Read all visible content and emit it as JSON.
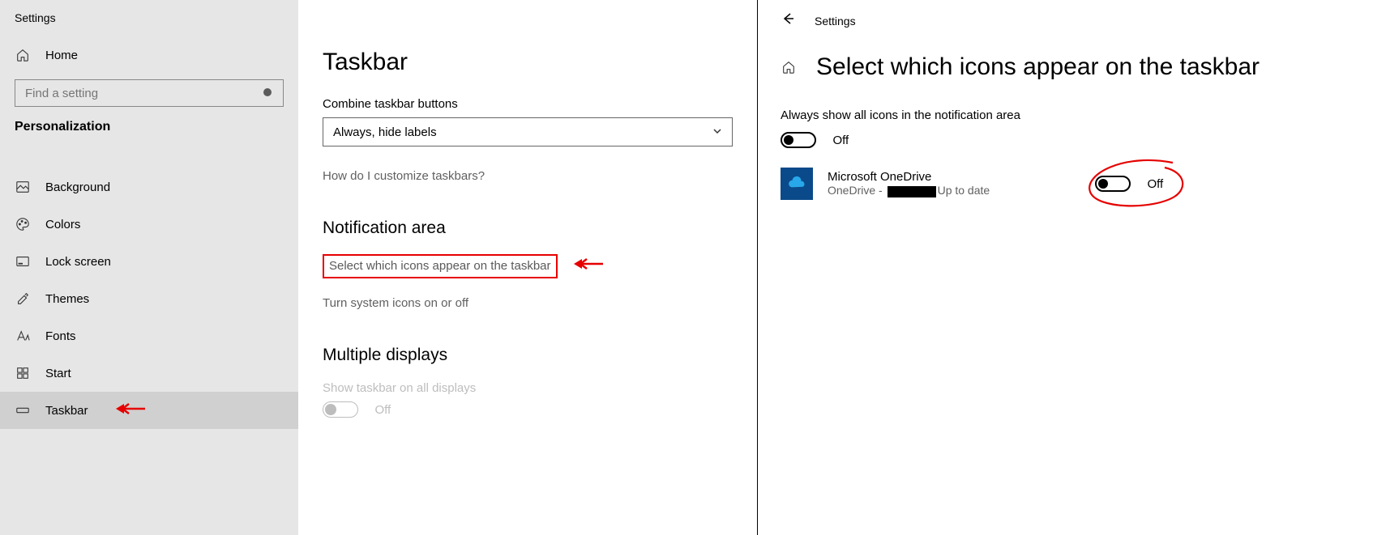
{
  "sidebar": {
    "app_title": "Settings",
    "home_label": "Home",
    "search_placeholder": "Find a setting",
    "section": "Personalization",
    "items": [
      {
        "label": "Background"
      },
      {
        "label": "Colors"
      },
      {
        "label": "Lock screen"
      },
      {
        "label": "Themes"
      },
      {
        "label": "Fonts"
      },
      {
        "label": "Start"
      },
      {
        "label": "Taskbar"
      }
    ]
  },
  "center": {
    "title": "Taskbar",
    "combo_label": "Combine taskbar buttons",
    "combo_value": "Always, hide labels",
    "help_link": "How do I customize taskbars?",
    "notif_heading": "Notification area",
    "link_select_icons": "Select which icons appear on the taskbar",
    "link_system_icons": "Turn system icons on or off",
    "multi_heading": "Multiple displays",
    "multi_option": "Show taskbar on all displays",
    "multi_toggle_state": "Off"
  },
  "right": {
    "breadcrumb": "Settings",
    "title": "Select which icons appear on the taskbar",
    "always_show_label": "Always show all icons in the notification area",
    "always_show_state": "Off",
    "app": {
      "name": "Microsoft OneDrive",
      "desc_prefix": "OneDrive - ",
      "desc_suffix": "Up to date",
      "state": "Off"
    }
  }
}
